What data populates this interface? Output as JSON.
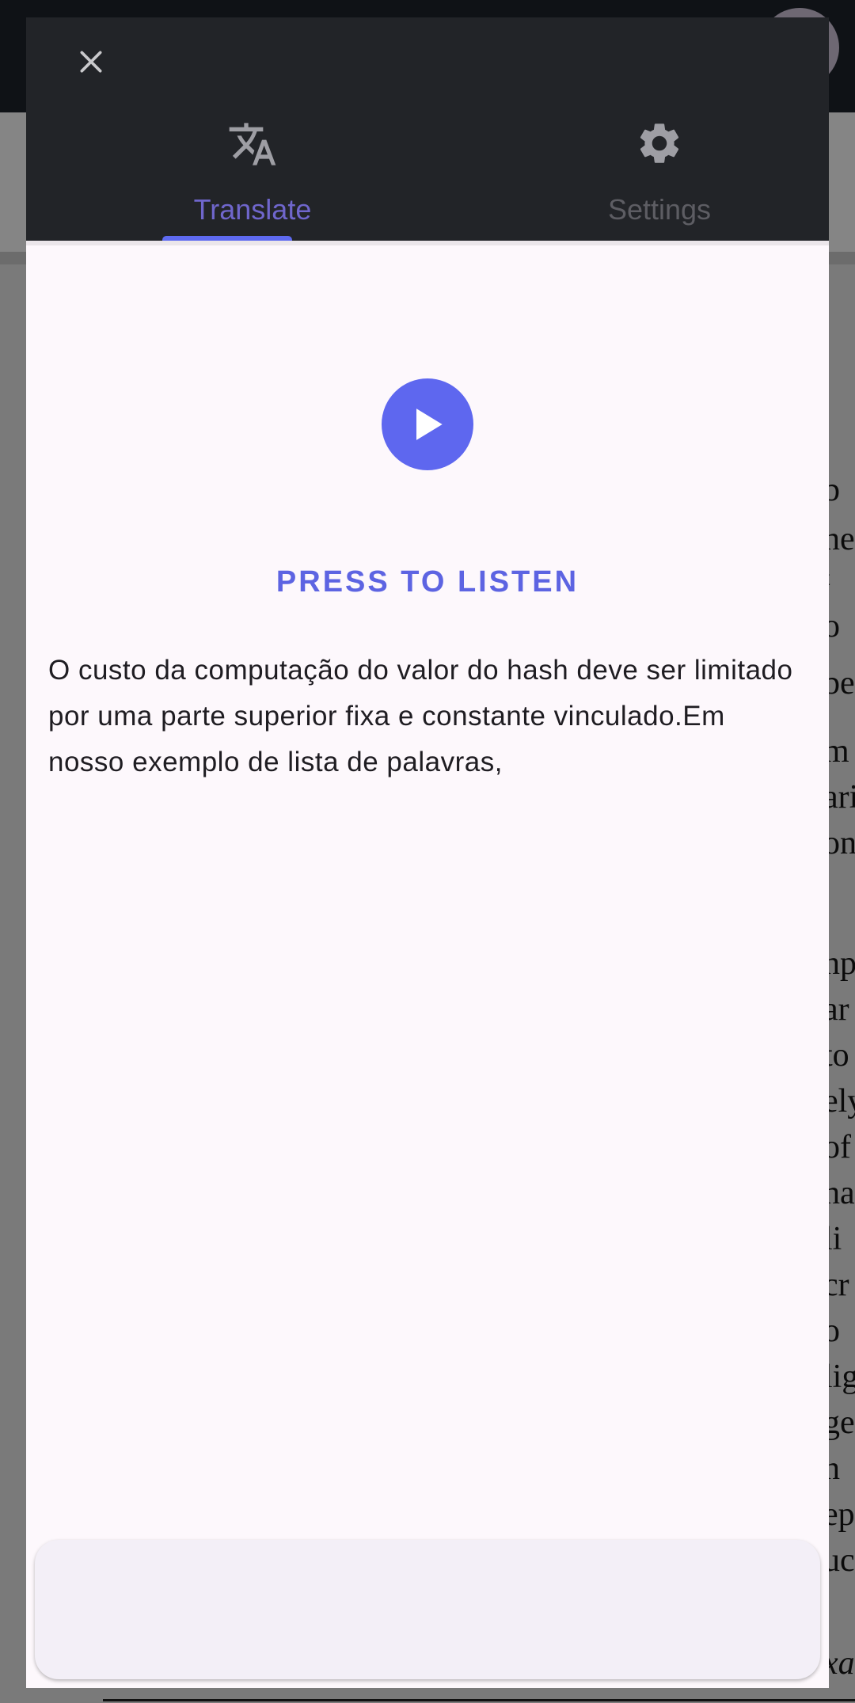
{
  "dialog": {
    "tabs": [
      {
        "label": "Translate",
        "icon": "translate-icon",
        "selected": true
      },
      {
        "label": "Settings",
        "icon": "gear-icon",
        "selected": false
      }
    ],
    "listen_label": "PRESS TO LISTEN",
    "translated_text": "O custo da computação do valor do hash deve ser limitado por uma parte superior fixa e constante vinculado.Em nosso exemplo de lista de palavras,",
    "colors": {
      "accent": "#5e67ef",
      "tab_selected": "#6f66cc",
      "header_bg": "#222428",
      "content_bg": "#fdf8fc"
    }
  },
  "background": {
    "text_fragments": [
      "b",
      "ne",
      "t",
      "o",
      "be",
      "m",
      "ari",
      "on",
      "np",
      "ar",
      "to",
      "ely",
      "of",
      "ha",
      "li",
      "cr",
      "o",
      "lig",
      "ge",
      "n",
      "ep",
      "uc",
      "xa"
    ]
  }
}
